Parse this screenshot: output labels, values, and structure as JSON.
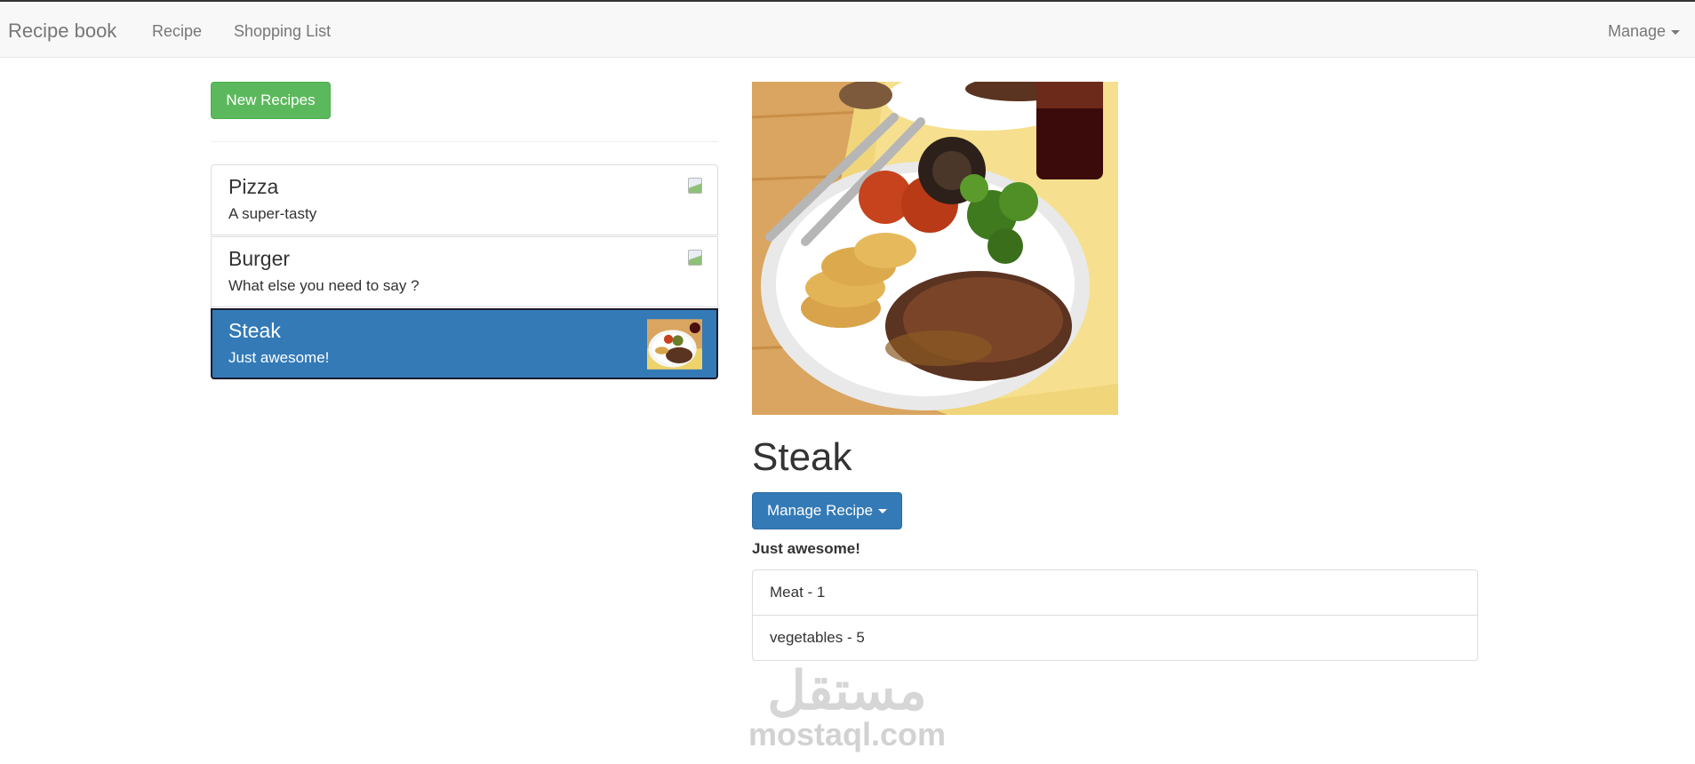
{
  "navbar": {
    "brand": "Recipe book",
    "links": [
      "Recipe",
      "Shopping List"
    ],
    "manage_label": "Manage"
  },
  "sidebar": {
    "new_button_label": "New Recipes",
    "recipes": [
      {
        "name": "Pizza",
        "description": "A super-tasty",
        "selected": false
      },
      {
        "name": "Burger",
        "description": "What else you need to say ?",
        "selected": false
      },
      {
        "name": "Steak",
        "description": "Just awesome!",
        "selected": true
      }
    ]
  },
  "detail": {
    "title": "Steak",
    "manage_button_label": "Manage Recipe",
    "description": "Just awesome!",
    "ingredients": [
      "Meat - 1",
      "vegetables - 5"
    ]
  },
  "watermark": {
    "arabic": "مستقل",
    "latin": "mostaql.com"
  },
  "colors": {
    "success": "#5cb85c",
    "primary": "#337ab7",
    "navbar_bg": "#f8f8f8"
  }
}
